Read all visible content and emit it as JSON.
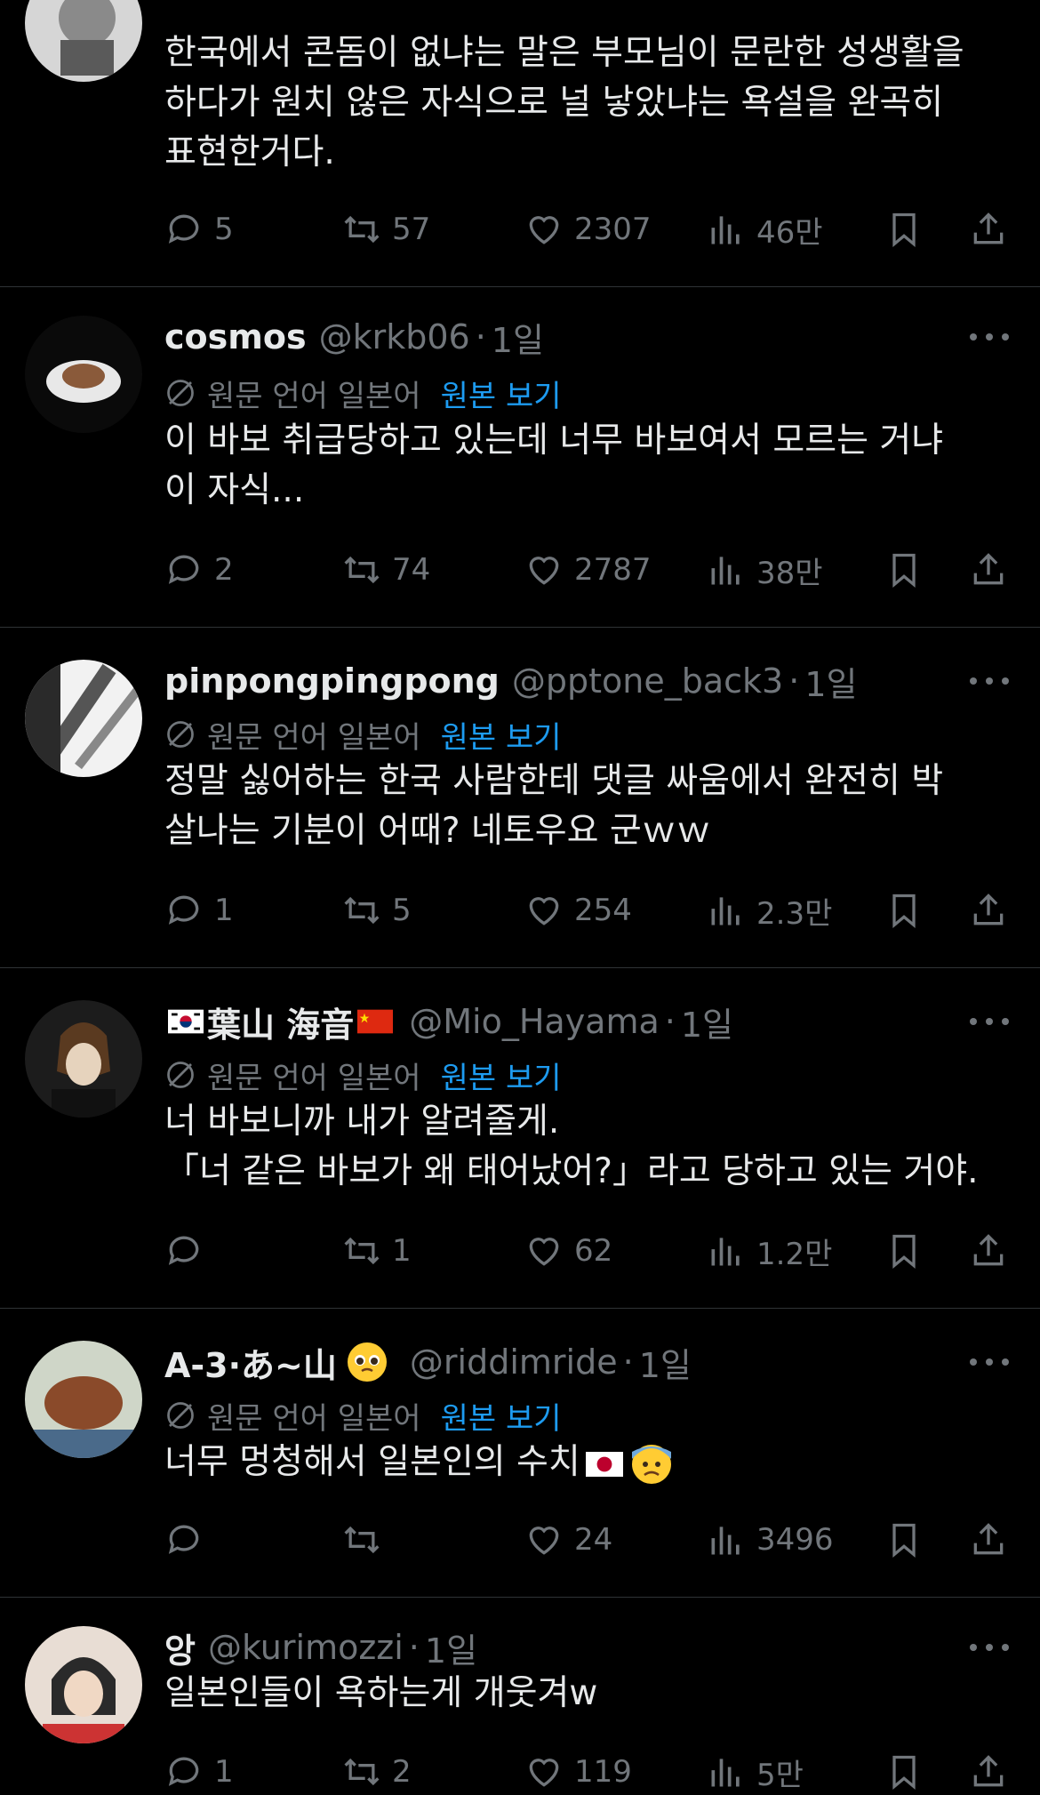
{
  "translation": {
    "lang_label": "원문 언어 일본어",
    "view_original": "원본 보기"
  },
  "tweets": [
    {
      "name": "",
      "handle": "",
      "time": "",
      "text_lines": [
        "한국에서 콘돔이 없냐는 말은 부모님이 문란한 성생활을",
        "하다가 원치 않은 자식으로 널 낳았냐는 욕설을 완곡히",
        "표현한거다."
      ],
      "replies": "5",
      "retweets": "57",
      "likes": "2307",
      "views": "46만"
    },
    {
      "name": "cosmos",
      "handle": "@krkb06",
      "time": "1일",
      "text_lines": [
        "이 바보 취급당하고 있는데 너무 바보여서 모르는 거냐",
        "이 자식..."
      ],
      "replies": "2",
      "retweets": "74",
      "likes": "2787",
      "views": "38만"
    },
    {
      "name": "pinpongpingpong",
      "handle": "@pptone_back3",
      "time": "1일",
      "text_lines": [
        "정말 싫어하는 한국 사람한테 댓글 싸움에서 완전히 박",
        "살나는 기분이 어때? 네토우요 군ｗｗ"
      ],
      "replies": "1",
      "retweets": "5",
      "likes": "254",
      "views": "2.3만"
    },
    {
      "name": "葉山 海音",
      "handle": "@Mio_Hayama",
      "time": "1일",
      "text_lines": [
        "너 바보니까 내가 알려줄게.",
        "「너 같은 바보가 왜 태어났어?」라고 당하고 있는 거야."
      ],
      "replies": "",
      "retweets": "1",
      "likes": "62",
      "views": "1.2만"
    },
    {
      "name": "A-3·あ~山",
      "handle": "@riddimride",
      "time": "1일",
      "text_lines": [
        "너무 멍청해서 일본인의 수치"
      ],
      "replies": "",
      "retweets": "",
      "likes": "24",
      "views": "3496"
    },
    {
      "name": "앙",
      "handle": "@kurimozzi",
      "time": "1일",
      "text_lines": [
        "일본인들이 욕하는게 개웃겨w"
      ],
      "replies": "1",
      "retweets": "2",
      "likes": "119",
      "views": "5만"
    }
  ],
  "colors": {
    "background": "#000000",
    "text": "#e7e9ea",
    "muted": "#71767b",
    "link": "#1d9bf0",
    "separator": "#2f3336"
  }
}
